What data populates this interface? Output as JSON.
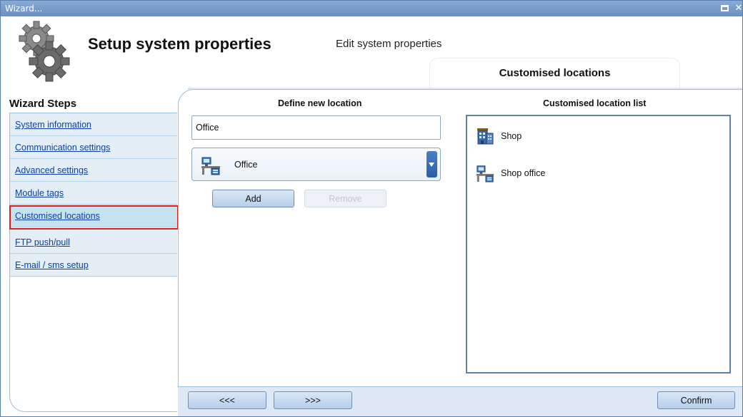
{
  "window": {
    "title": "Wizard...",
    "controls": [
      "maximize-icon",
      "close-icon"
    ]
  },
  "header": {
    "title": "Setup system properties",
    "subtitle": "Edit system properties",
    "tab_label": "Customised locations",
    "icon": "gears-icon"
  },
  "wizard": {
    "title": "Wizard Steps",
    "steps": [
      {
        "label": "System information"
      },
      {
        "label": "Communication settings"
      },
      {
        "label": "Advanced settings"
      },
      {
        "label": "Module tags"
      },
      {
        "label": "Customised locations",
        "active": true
      },
      {
        "label": "FTP push/pull"
      },
      {
        "label": "E-mail / sms setup"
      }
    ]
  },
  "define": {
    "title": "Define new location",
    "name_value": "Office",
    "location_type": {
      "selected": "Office",
      "icon": "office-desk-icon"
    },
    "add_label": "Add",
    "remove_label": "Remove"
  },
  "list": {
    "title": "Customised location list",
    "items": [
      {
        "label": "Shop",
        "icon": "shop-building-icon"
      },
      {
        "label": "Shop office",
        "icon": "office-desk-icon"
      }
    ]
  },
  "footer": {
    "back_label": "<<<",
    "next_label": ">>>",
    "confirm_label": "Confirm"
  },
  "colors": {
    "frame": "#dfe9f5",
    "link": "#0d3fa8",
    "active_step": "#c5e3ee",
    "highlight_border": "#e02020"
  }
}
